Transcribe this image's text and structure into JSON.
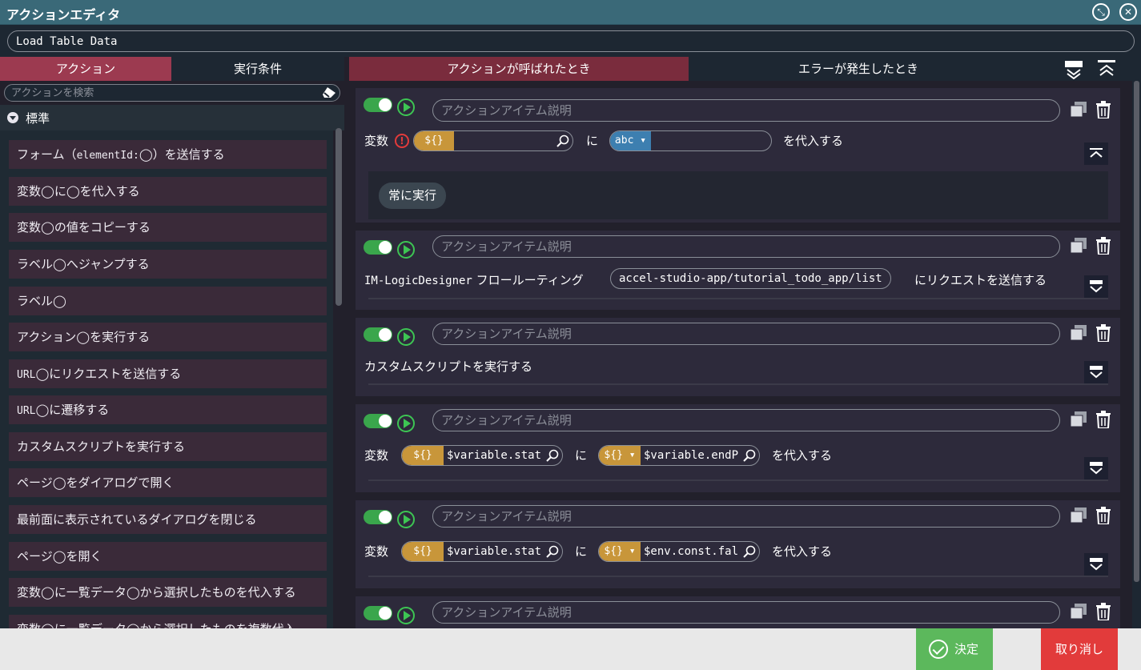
{
  "window": {
    "title": "アクションエディタ"
  },
  "action_name": "Load Table Data",
  "left_tabs": [
    {
      "label": "アクション"
    },
    {
      "label": "実行条件"
    }
  ],
  "search": {
    "placeholder": "アクションを検索"
  },
  "category": {
    "label": "標準"
  },
  "palette": [
    {
      "pre": "フォーム（",
      "mono": "elementId:",
      "post": "）を送信する"
    },
    {
      "pre": "変数",
      "mono": "",
      "post": "に",
      "post2": "を代入する"
    },
    {
      "pre": "変数",
      "mono": "",
      "post": "の値をコピーする"
    },
    {
      "pre": "ラベル",
      "mono": "",
      "post": "へジャンプする"
    },
    {
      "pre": "ラベル",
      "mono": "",
      "post": ""
    },
    {
      "pre": "アクション",
      "mono": "",
      "post": "を実行する"
    },
    {
      "pre": "",
      "mono": "URL",
      "post": "にリクエストを送信する"
    },
    {
      "pre": "",
      "mono": "URL",
      "post": "に遷移する"
    },
    {
      "pre": "カスタムスクリプトを実行する",
      "mono": "",
      "post": ""
    },
    {
      "pre": "ページ",
      "mono": "",
      "post": "をダイアログで開く"
    },
    {
      "pre": "最前面に表示されているダイアログを閉じる",
      "mono": "",
      "post": ""
    },
    {
      "pre": "ページ",
      "mono": "",
      "post": "を開く"
    },
    {
      "pre": "変数",
      "mono": "",
      "post": "に一覧データ",
      "post2": "から選択したものを代入する"
    },
    {
      "pre": "変数",
      "mono": "",
      "post": "に一覧データ",
      "post2": "から選択したものを複数代入"
    }
  ],
  "right_tabs": [
    {
      "label": "アクションが呼ばれたとき"
    },
    {
      "label": "エラーが発生したとき"
    }
  ],
  "desc_placeholder": "アクションアイテム説明",
  "words": {
    "hensu": "変数",
    "ni": "に",
    "wo_dainyu": "を代入する",
    "var_tag": "${}",
    "abc_tag": "abc ▾",
    "var_tag_drop": "${} ▾"
  },
  "cards": {
    "c1": {
      "condition": "常に実行"
    },
    "c2": {
      "prefix_mono": "IM-LogicDesigner",
      "prefix": " フロールーティング",
      "path": "accel-studio-app/tutorial_todo_app/list",
      "suffix": "にリクエストを送信する"
    },
    "c3": {
      "text": "カスタムスクリプトを実行する"
    },
    "c4": {
      "left_val": "$variable.stat",
      "right_val": "$variable.endP"
    },
    "c5": {
      "left_val": "$variable.stat",
      "right_val": "$env.const.fal"
    }
  },
  "footer": {
    "ok_label": "決定",
    "cancel_label": "取り消し"
  },
  "colors": {
    "accent": "#9c3a50",
    "toggle_on": "#3aa64c",
    "var_tag": "#c8963a",
    "ok": "#5cb85c",
    "cancel": "#e23b3b"
  }
}
